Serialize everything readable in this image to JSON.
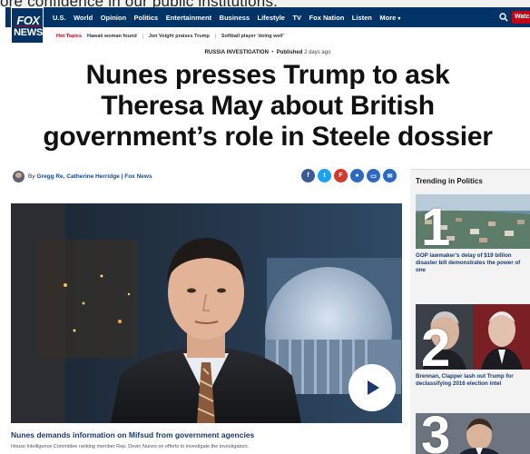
{
  "background_text": "ore confidence in our public institutions.",
  "logo": {
    "line1": "FOX",
    "line2": "NEWS"
  },
  "nav": {
    "items": [
      "U.S.",
      "World",
      "Opinion",
      "Politics",
      "Entertainment",
      "Business",
      "Lifestyle",
      "TV",
      "Fox Nation",
      "Listen",
      "More"
    ],
    "more_caret": "▾",
    "watch_label": "Watch"
  },
  "hot_topics": {
    "label": "Hot Topics",
    "items": [
      "Hawaii woman found",
      "Jon Voight praises Trump",
      "Softball player 'doing well'"
    ]
  },
  "article": {
    "category": "RUSSIA INVESTIGATION",
    "separator": "•",
    "published_label": "Published",
    "published_time": "2 days ago",
    "headline": "Nunes presses Trump to ask Theresa May about British government’s role in Steele dossier",
    "byline_prefix": "By",
    "authors": "Gregg Re, Catherine Herridge",
    "outlet": "| Fox News"
  },
  "share_buttons": [
    {
      "icon": "facebook-icon",
      "glyph": "f"
    },
    {
      "icon": "twitter-icon",
      "glyph": "t"
    },
    {
      "icon": "flipboard-icon",
      "glyph": "F"
    },
    {
      "icon": "comments-icon",
      "glyph": "●"
    },
    {
      "icon": "print-icon",
      "glyph": "▭"
    },
    {
      "icon": "email-icon",
      "glyph": "✉"
    }
  ],
  "video": {
    "title": "Nunes demands information on Mifsud from government agencies",
    "description": "House Intelligence Committee ranking member Rep. Devin Nunes on efforts to investigate the investigators."
  },
  "sidebar": {
    "heading": "Trending in Politics",
    "items": [
      {
        "rank": "1",
        "title": "GOP lawmaker's delay of $19 billion disaster bill demonstrates the power of one"
      },
      {
        "rank": "2",
        "title": "Brennan, Clapper lash out Trump for declassifying 2016 election intel"
      },
      {
        "rank": "3",
        "title": ""
      }
    ]
  },
  "colors": {
    "nav_bg": "#003366",
    "accent_red": "#c20017",
    "link_blue": "#1a3a6e"
  }
}
